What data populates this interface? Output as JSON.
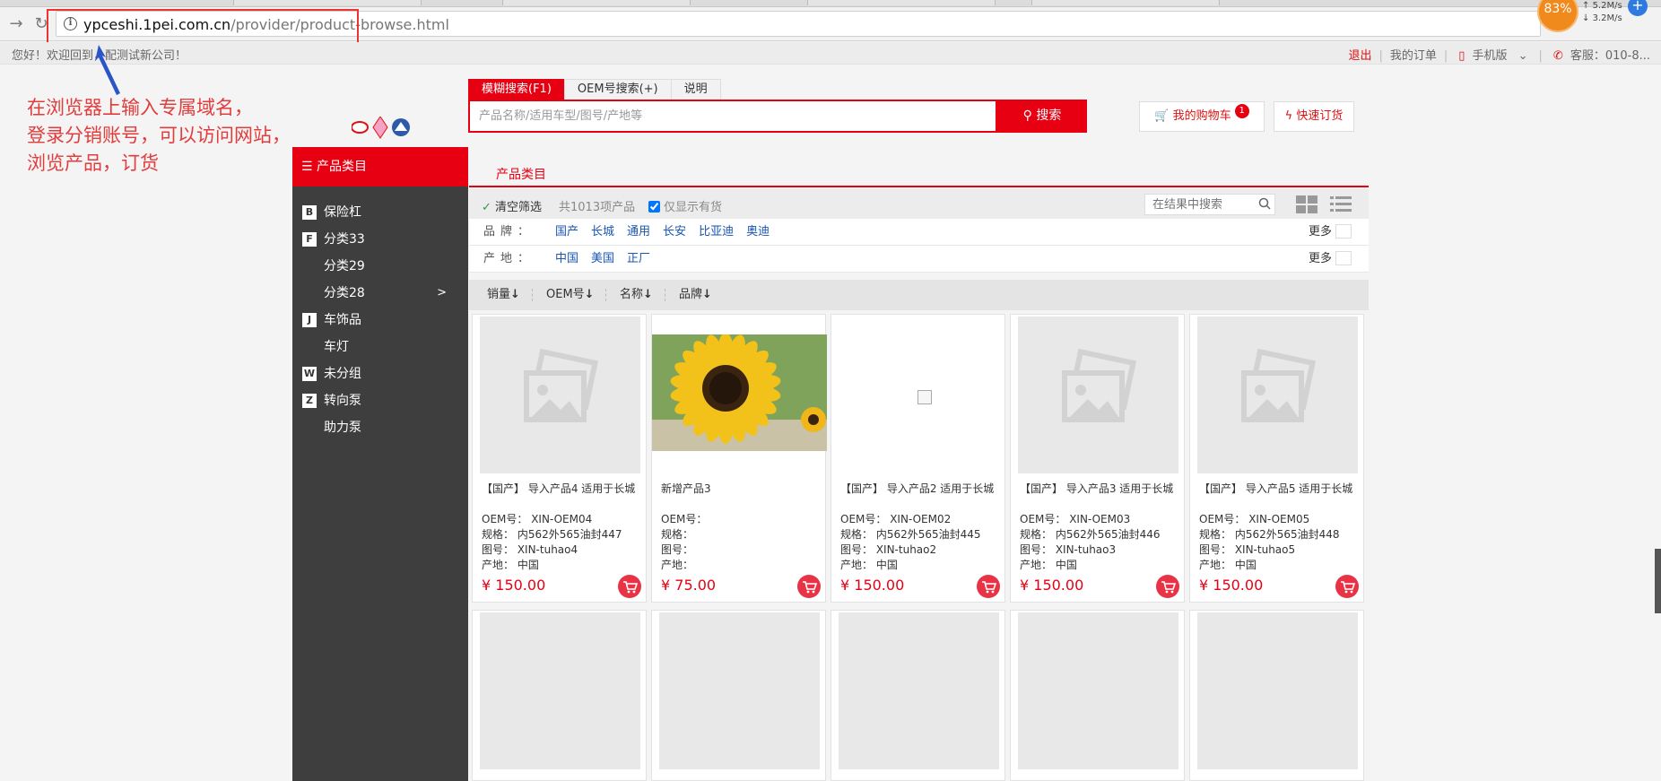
{
  "browser": {
    "url_host": "ypceshi.1pei.com.cn",
    "url_path": "/provider/product-browse.html",
    "speed_percent": "83%",
    "speed_up": "5.2M/s",
    "speed_down": "3.2M/s"
  },
  "sitebar": {
    "greeting": "您好！欢迎回到，配测试新公司！",
    "logout": "退出",
    "my_orders": "我的订单",
    "mobile": "手机版",
    "service": "客服：010-8..."
  },
  "annotation": {
    "line1": "在浏览器上输入专属域名，",
    "line2": "登录分销账号，可以访问网站，",
    "line3": "浏览产品，订货"
  },
  "search": {
    "tabs": [
      "模糊搜索(F1)",
      "OEM号搜索(+)",
      "说明"
    ],
    "placeholder": "产品名称/适用车型/图号/产地等",
    "button": "搜索",
    "cart": "我的购物车",
    "cart_count": "1",
    "quick_order": "快速订货"
  },
  "sidebar": {
    "header": "产品类目",
    "items": [
      {
        "letter": "B",
        "label": "保险杠"
      },
      {
        "letter": "F",
        "label": "分类33"
      },
      {
        "letter": "",
        "label": "分类29"
      },
      {
        "letter": "",
        "label": "分类28",
        "arrow": ">"
      },
      {
        "letter": "J",
        "label": "车饰品"
      },
      {
        "letter": "",
        "label": "车灯"
      },
      {
        "letter": "W",
        "label": "未分组"
      },
      {
        "letter": "Z",
        "label": "转向泵"
      },
      {
        "letter": "",
        "label": "助力泵"
      }
    ]
  },
  "content": {
    "tab": "产品类目",
    "clear_filter": "清空筛选",
    "count": "共1013项产品",
    "in_stock": "仅显示有货",
    "result_search_placeholder": "在结果中搜索",
    "brand_label": "品牌：",
    "brands": [
      "国产",
      "长城",
      "通用",
      "长安",
      "比亚迪",
      "奥迪"
    ],
    "origin_label": "产地：",
    "origins": [
      "中国",
      "美国",
      "正厂"
    ],
    "more": "更多",
    "sorts": [
      "销量",
      "OEM号",
      "名称",
      "品牌"
    ],
    "sort_dir": "↓"
  },
  "products": [
    {
      "name": "【国产】 导入产品4 适用于长城",
      "oem": "OEM号： XIN-OEM04",
      "spec": "规格： 内562外565油封447",
      "drawing": "图号： XIN-tuhao4",
      "origin": "产地： 中国",
      "price": "¥ 150.00",
      "image": "placeholder"
    },
    {
      "name": "新增产品3",
      "oem": "OEM号：",
      "spec": "规格：",
      "drawing": "图号：",
      "origin": "产地：",
      "price": "¥ 75.00",
      "image": "sunflower"
    },
    {
      "name": "【国产】 导入产品2 适用于长城",
      "oem": "OEM号： XIN-OEM02",
      "spec": "规格： 内562外565油封445",
      "drawing": "图号： XIN-tuhao2",
      "origin": "产地： 中国",
      "price": "¥ 150.00",
      "image": "broken"
    },
    {
      "name": "【国产】 导入产品3 适用于长城",
      "oem": "OEM号： XIN-OEM03",
      "spec": "规格： 内562外565油封446",
      "drawing": "图号： XIN-tuhao3",
      "origin": "产地： 中国",
      "price": "¥ 150.00",
      "image": "placeholder"
    },
    {
      "name": "【国产】 导入产品5 适用于长城",
      "oem": "OEM号： XIN-OEM05",
      "spec": "规格： 内562外565油封448",
      "drawing": "图号： XIN-tuhao5",
      "origin": "产地： 中国",
      "price": "¥ 150.00",
      "image": "placeholder"
    }
  ],
  "colors": {
    "brand_red": "#e60012",
    "sidebar_bg": "#3e3e3e",
    "link_blue": "#1a55b3",
    "annotation_red": "#e23c3c"
  }
}
